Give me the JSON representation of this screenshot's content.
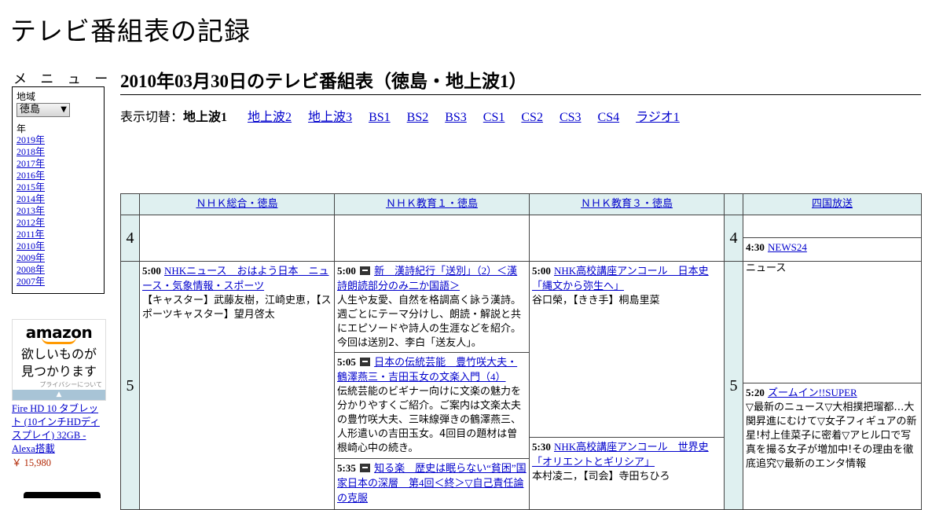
{
  "site_title": "テレビ番組表の記録",
  "menu": {
    "label": "メ ニ ュ ー",
    "region_label": "地域",
    "region_value": "徳島",
    "year_label": "年",
    "years": [
      "2019年",
      "2018年",
      "2017年",
      "2016年",
      "2015年",
      "2014年",
      "2013年",
      "2012年",
      "2011年",
      "2010年",
      "2009年",
      "2008年",
      "2007年"
    ]
  },
  "ad": {
    "logo": "amazon",
    "copy_line1": "欲しいものが",
    "copy_line2": "見つかります",
    "privacy": "プライバシーについて",
    "product_name": "Fire HD 10 タブレット (10インチHDディスプレイ) 32GB - Alexa搭載",
    "price": "￥ 15,980"
  },
  "heading": "2010年03月30日のテレビ番組表（徳島・地上波1）",
  "switcher": {
    "label": "表示切替：",
    "current": "地上波1",
    "links": [
      "地上波2",
      "地上波3",
      "BS1",
      "BS2",
      "BS3",
      "CS1",
      "CS2",
      "CS3",
      "CS4",
      "ラジオ1"
    ]
  },
  "channels": [
    "ＮＨＫ総合・徳島",
    "ＮＨＫ教育１・徳島",
    "ＮＨＫ教育３・徳島",
    "四国放送"
  ],
  "hours": [
    "4",
    "5"
  ],
  "programs": {
    "ch1": [
      {
        "time": "5:00",
        "title": "NHKニュース　おはよう日本　ニュース・気象情報・スポーツ",
        "desc": "【キャスター】武藤友樹，江崎史恵，【スポーツキャスター】望月啓太"
      }
    ],
    "ch2": [
      {
        "time": "5:00",
        "title": "新　漢詩紀行「送別」（2）＜漢詩朗読部分のみ二か国語＞",
        "desc": "人生や友愛、自然を格調高く詠う漢詩。週ごとにテーマ分けし、朗読・解説と共にエピソードや詩人の生涯などを紹介。今回は送別2、李白「送友人」。"
      },
      {
        "time": "5:05",
        "title": "日本の伝統芸能　豊竹咲大夫・鶴澤燕三・吉田玉女の文楽入門（4）",
        "desc": "伝統芸能のビギナー向けに文楽の魅力を分かりやすくご紹介。ご案内は文楽太夫の豊竹咲大夫、三味線弾きの鶴澤燕三、人形遣いの吉田玉女。4回目の題材は曽根崎心中の続き。"
      },
      {
        "time": "5:35",
        "title": "知る楽　歴史は眠らない“貧困”国家日本の深層　第4回＜終＞▽自己責任論の克服",
        "desc": ""
      }
    ],
    "ch3": [
      {
        "time": "5:00",
        "title": "NHK高校講座アンコール　日本史「縄文から弥生へ」",
        "desc": "谷口榮，【きき手】桐島里菜"
      },
      {
        "time": "5:30",
        "title": "NHK高校講座アンコール　世界史「オリエントとギリシア」",
        "desc": "本村凌二，【司会】寺田ちひろ"
      }
    ],
    "ch4": [
      {
        "time": "4:30",
        "title": "NEWS24",
        "desc": "ニュース"
      },
      {
        "time": "5:20",
        "title": "ズームイン!!SUPER",
        "desc": "▽最新のニュース▽大相撲把瑠都…大関昇進にむけて▽女子フィギュアの新星!村上佳菜子に密着▽アヒル口で写真を撮る女子が増加中!その理由を徹底追究▽最新のエンタ情報"
      }
    ]
  }
}
